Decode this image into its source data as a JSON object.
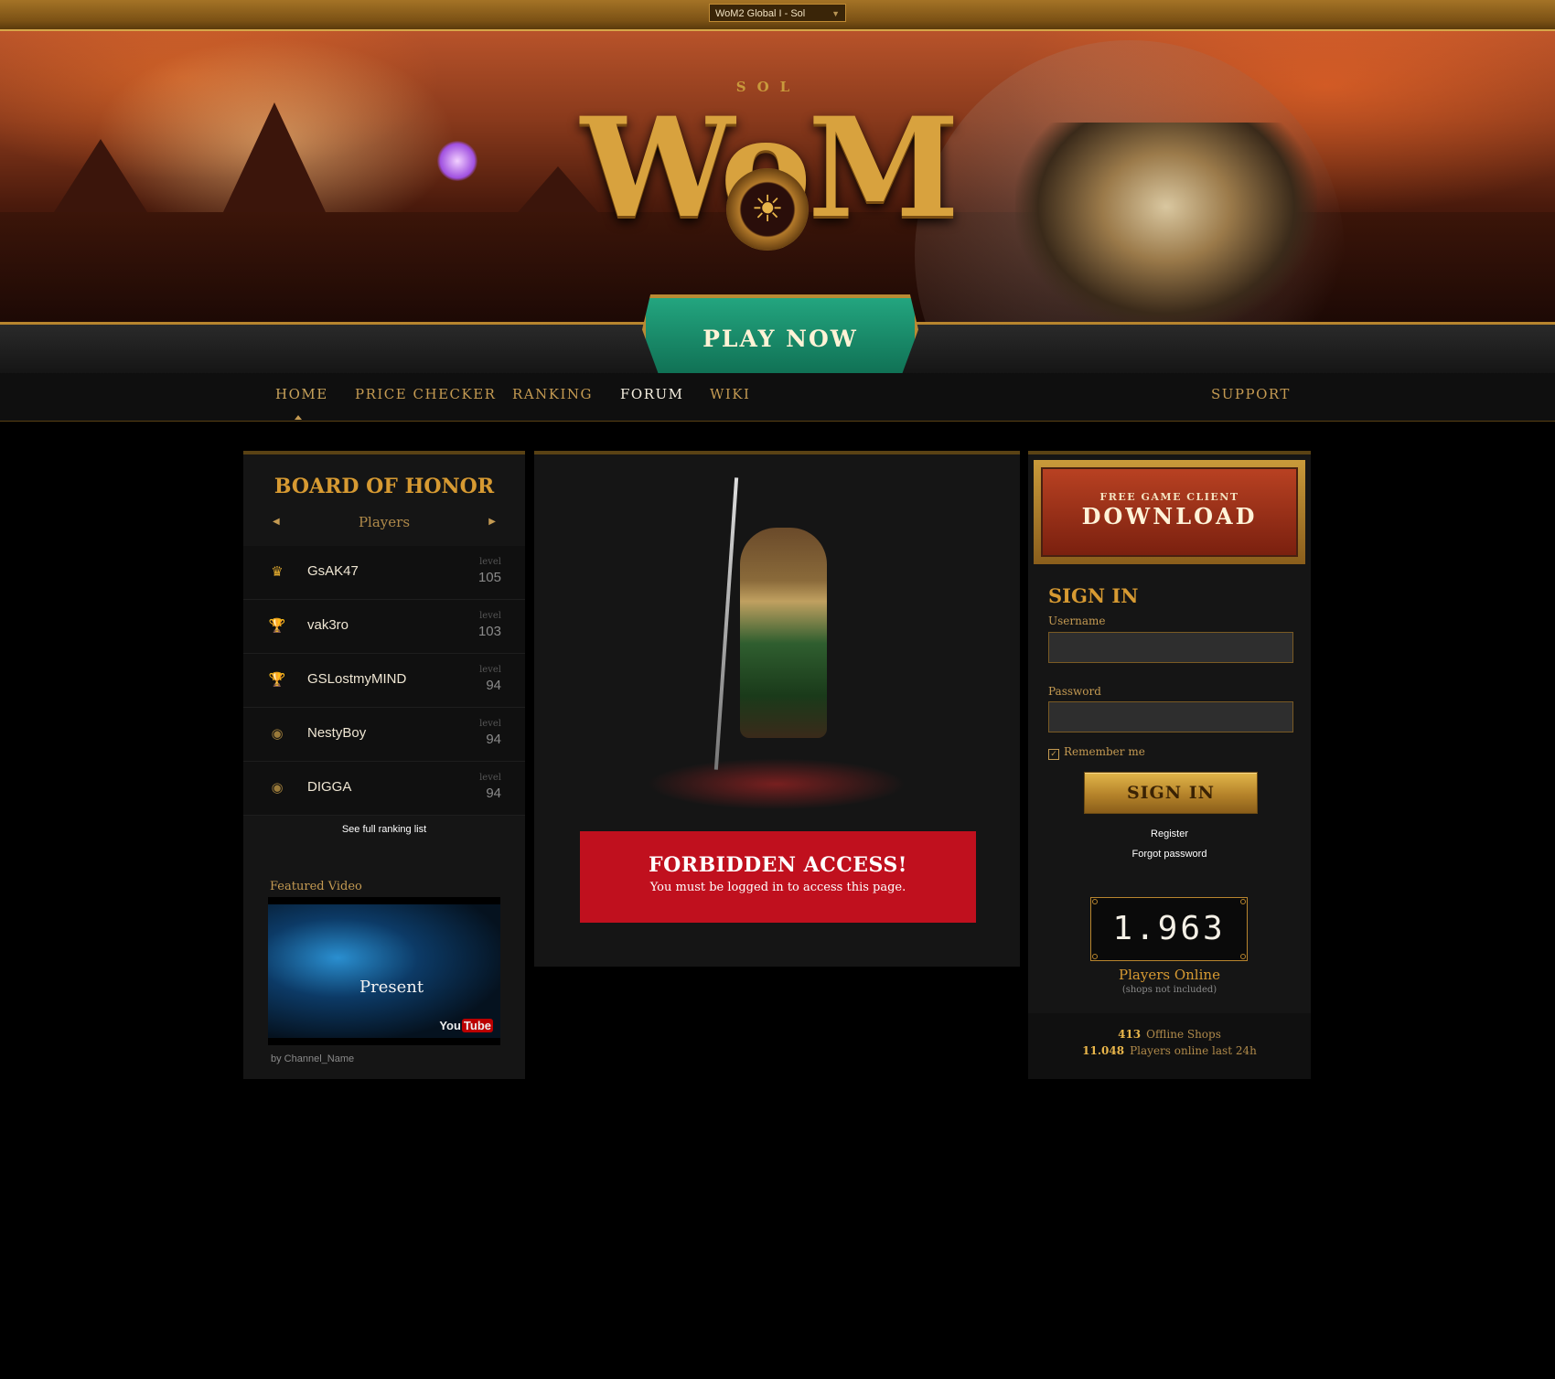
{
  "header": {
    "server_select": "WoM2 Global I - Sol",
    "logo_sub": "SOL",
    "logo_text": "WoM"
  },
  "play_now": "PLAY NOW",
  "nav": {
    "items": [
      "HOME",
      "PRICE CHECKER",
      "RANKING",
      "FORUM",
      "WIKI"
    ],
    "support": "SUPPORT",
    "active": "HOME",
    "hover": "FORUM"
  },
  "board": {
    "title": "BOARD OF HONOR",
    "category": "Players",
    "level_label": "level",
    "rows": [
      {
        "icon": "crown-icon",
        "name": "GsAK47",
        "level": "105"
      },
      {
        "icon": "silver-trophy-icon",
        "name": "vak3ro",
        "level": "103"
      },
      {
        "icon": "bronze-trophy-icon",
        "name": "GSLostmyMIND",
        "level": "94"
      },
      {
        "icon": "medal-icon",
        "name": "NestyBoy",
        "level": "94"
      },
      {
        "icon": "medal-icon",
        "name": "DIGGA",
        "level": "94"
      }
    ],
    "see_full": "See full ranking list"
  },
  "video": {
    "label": "Featured Video",
    "overlay": "Present",
    "logo": "You",
    "logo_tube": "Tube",
    "channel": "by Channel_Name"
  },
  "forbidden": {
    "title": "FORBIDDEN ACCESS!",
    "message": "You must be logged in to access this page."
  },
  "download": {
    "small": "FREE GAME CLIENT",
    "big": "DOWNLOAD"
  },
  "signin": {
    "title": "SIGN IN",
    "username_label": "Username",
    "password_label": "Password",
    "remember": "Remember me",
    "button": "SIGN IN",
    "register": "Register",
    "forgot": "Forgot password"
  },
  "online": {
    "count": "1.963",
    "label": "Players Online",
    "sub": "(shops not included)",
    "offline_shops_value": "413",
    "offline_shops_label": "Offline Shops",
    "last24_value": "11.048",
    "last24_label": "Players online last 24h"
  },
  "colors": {
    "gold": "#c8a25a",
    "accent_red": "#c0101e",
    "play_green": "#1a8a67"
  }
}
